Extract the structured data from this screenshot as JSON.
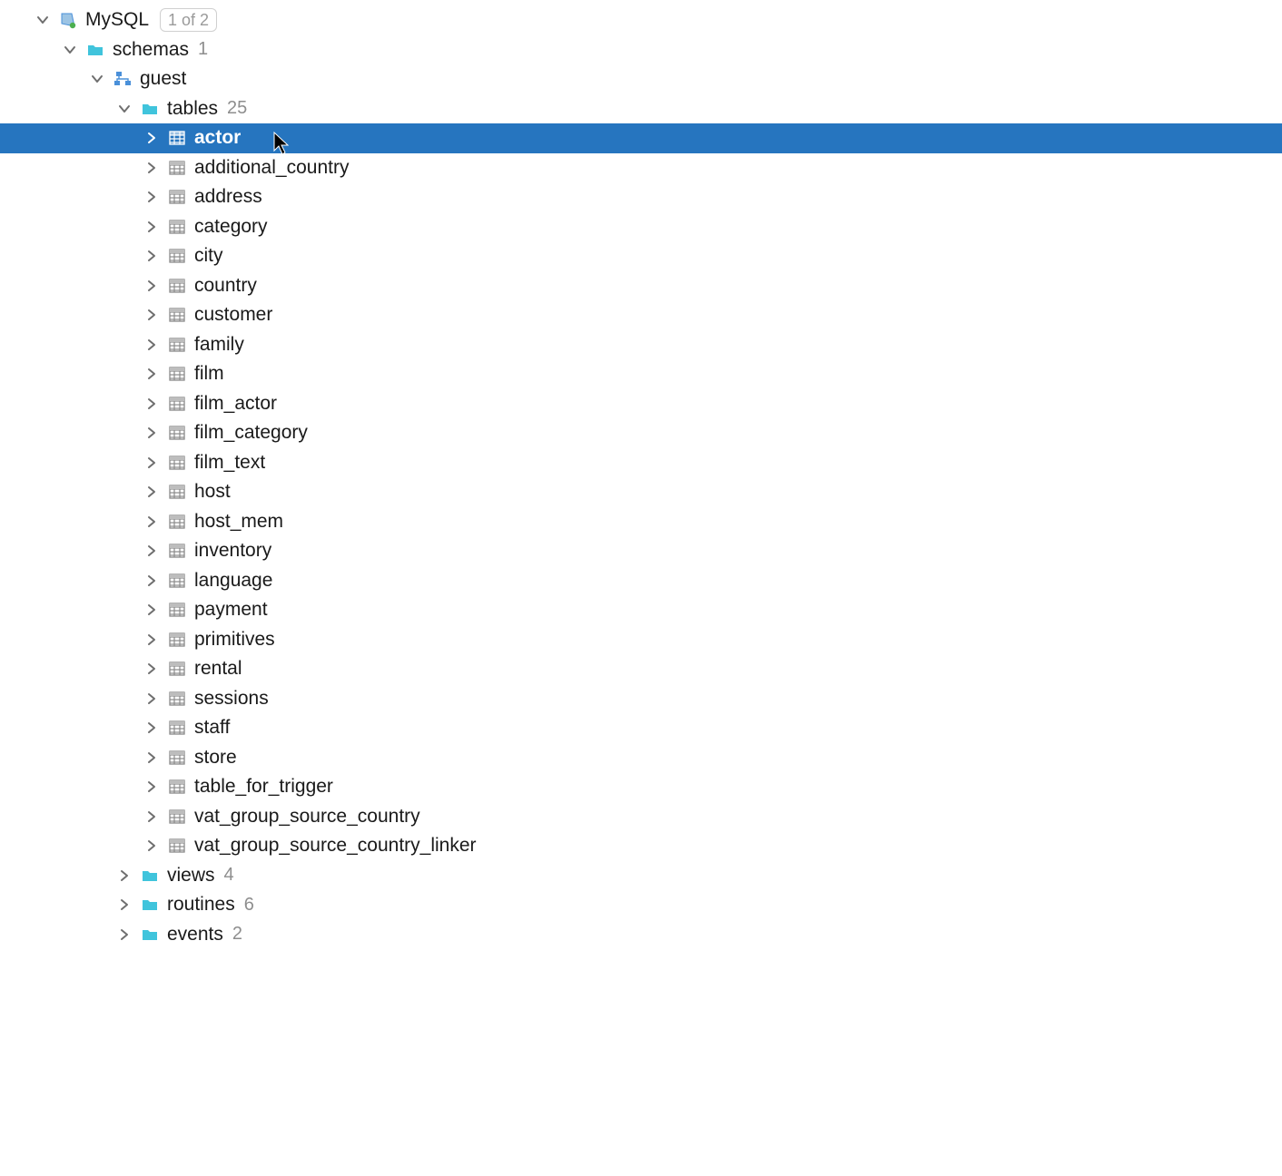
{
  "datasource": {
    "name": "MySQL",
    "badge": "1 of 2"
  },
  "folders": {
    "schemas": {
      "label": "schemas",
      "count": "1"
    },
    "guest": {
      "label": "guest"
    },
    "tables": {
      "label": "tables",
      "count": "25"
    },
    "views": {
      "label": "views",
      "count": "4"
    },
    "routines": {
      "label": "routines",
      "count": "6"
    },
    "events": {
      "label": "events",
      "count": "2"
    }
  },
  "tables": [
    "actor",
    "additional_country",
    "address",
    "category",
    "city",
    "country",
    "customer",
    "family",
    "film",
    "film_actor",
    "film_category",
    "film_text",
    "host",
    "host_mem",
    "inventory",
    "language",
    "payment",
    "primitives",
    "rental",
    "sessions",
    "staff",
    "store",
    "table_for_trigger",
    "vat_group_source_country",
    "vat_group_source_country_linker"
  ],
  "selected_table_index": 0
}
